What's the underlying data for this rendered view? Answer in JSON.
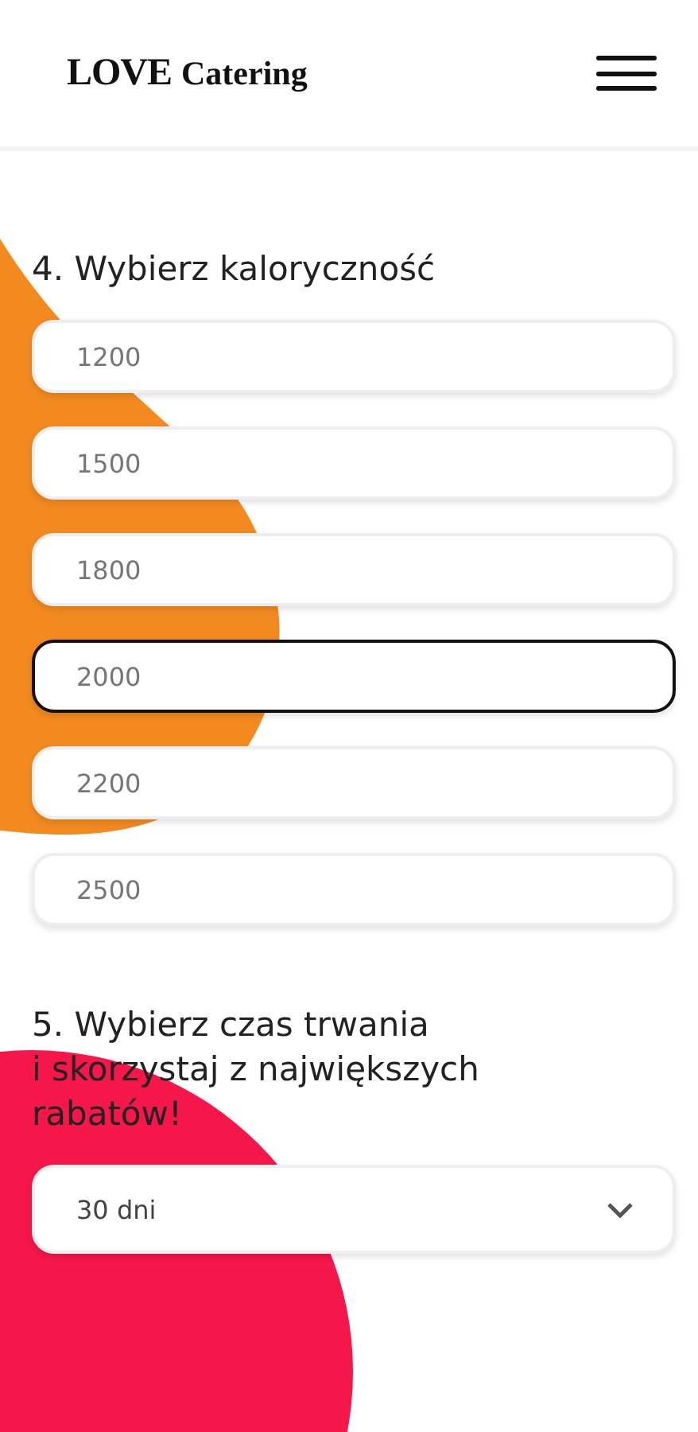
{
  "header": {
    "logo_mark": "LOVE",
    "logo_text": "Catering"
  },
  "calories": {
    "heading": "4. Wybierz kaloryczność",
    "options": [
      {
        "label": "1200",
        "selected": false
      },
      {
        "label": "1500",
        "selected": false
      },
      {
        "label": "1800",
        "selected": false
      },
      {
        "label": "2000",
        "selected": true
      },
      {
        "label": "2200",
        "selected": false
      },
      {
        "label": "2500",
        "selected": false
      }
    ]
  },
  "duration": {
    "heading_lines": [
      "5. Wybierz czas trwania",
      "i skorzystaj z największych",
      "rabatów!"
    ],
    "value": "30 dni"
  }
}
